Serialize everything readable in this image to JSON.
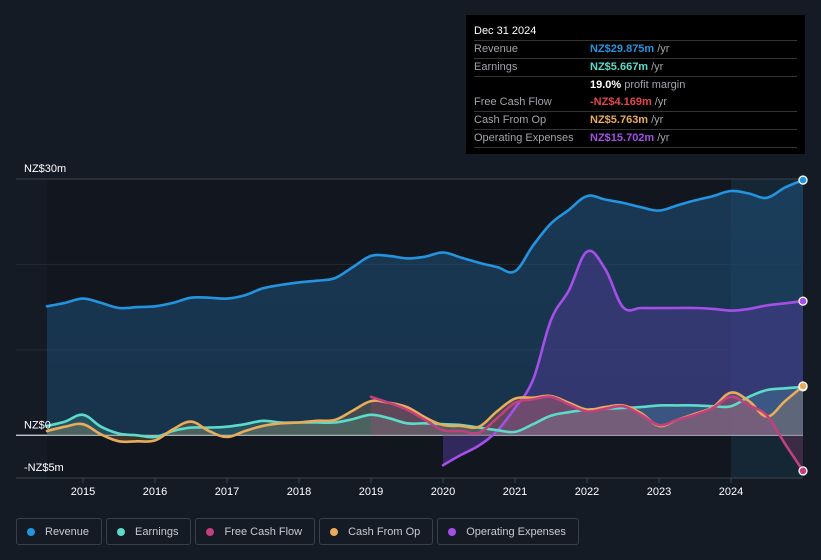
{
  "tooltip": {
    "date": "Dec 31 2024",
    "rows": [
      {
        "label": "Revenue",
        "value": "NZ$29.875m",
        "unit": "/yr",
        "color": "#2394df"
      },
      {
        "label": "Earnings",
        "value": "NZ$5.667m",
        "unit": "/yr",
        "color": "#5ddbc9"
      },
      {
        "label": "",
        "value": "19.0%",
        "unit": "profit margin",
        "color": "#ffffff"
      },
      {
        "label": "Free Cash Flow",
        "value": "-NZ$4.169m",
        "unit": "/yr",
        "color": "#e4474b"
      },
      {
        "label": "Cash From Op",
        "value": "NZ$5.763m",
        "unit": "/yr",
        "color": "#e9ac5a"
      },
      {
        "label": "Operating Expenses",
        "value": "NZ$15.702m",
        "unit": "/yr",
        "color": "#a450e8"
      }
    ]
  },
  "legend": [
    {
      "label": "Revenue",
      "color": "#2394df"
    },
    {
      "label": "Earnings",
      "color": "#5ddbc9"
    },
    {
      "label": "Free Cash Flow",
      "color": "#c2407f"
    },
    {
      "label": "Cash From Op",
      "color": "#e9ac5a"
    },
    {
      "label": "Operating Expenses",
      "color": "#a450e8"
    }
  ],
  "chart_data": {
    "type": "area",
    "title": "",
    "xlabel": "",
    "ylabel": "",
    "ylim": [
      -5,
      30
    ],
    "xlim": [
      2014.5,
      2025.0
    ],
    "y_ticks": [
      {
        "value": 30,
        "label": "NZ$30m"
      },
      {
        "value": 0,
        "label": "NZ$0"
      },
      {
        "value": -5,
        "label": "-NZ$5m"
      }
    ],
    "x_ticks": [
      {
        "value": 2015,
        "label": "2015"
      },
      {
        "value": 2016,
        "label": "2016"
      },
      {
        "value": 2017,
        "label": "2017"
      },
      {
        "value": 2018,
        "label": "2018"
      },
      {
        "value": 2019,
        "label": "2019"
      },
      {
        "value": 2020,
        "label": "2020"
      },
      {
        "value": 2021,
        "label": "2021"
      },
      {
        "value": 2022,
        "label": "2022"
      },
      {
        "value": 2023,
        "label": "2023"
      },
      {
        "value": 2024,
        "label": "2024"
      }
    ],
    "grid": true,
    "legend_position": "bottom-left",
    "highlight_start": 2024.0,
    "series": [
      {
        "name": "Revenue",
        "color": "#2394df",
        "points": [
          [
            2014.5,
            15.1
          ],
          [
            2014.75,
            15.5
          ],
          [
            2015.0,
            16.0
          ],
          [
            2015.25,
            15.5
          ],
          [
            2015.5,
            14.9
          ],
          [
            2015.75,
            15.0
          ],
          [
            2016.0,
            15.1
          ],
          [
            2016.25,
            15.5
          ],
          [
            2016.5,
            16.1
          ],
          [
            2016.75,
            16.1
          ],
          [
            2017.0,
            16.0
          ],
          [
            2017.25,
            16.4
          ],
          [
            2017.5,
            17.2
          ],
          [
            2017.75,
            17.6
          ],
          [
            2018.0,
            17.9
          ],
          [
            2018.25,
            18.1
          ],
          [
            2018.5,
            18.4
          ],
          [
            2018.75,
            19.7
          ],
          [
            2019.0,
            21.0
          ],
          [
            2019.25,
            21.0
          ],
          [
            2019.5,
            20.7
          ],
          [
            2019.75,
            20.9
          ],
          [
            2020.0,
            21.4
          ],
          [
            2020.25,
            20.8
          ],
          [
            2020.5,
            20.2
          ],
          [
            2020.75,
            19.7
          ],
          [
            2021.0,
            19.2
          ],
          [
            2021.25,
            22.2
          ],
          [
            2021.5,
            24.8
          ],
          [
            2021.75,
            26.4
          ],
          [
            2022.0,
            28.0
          ],
          [
            2022.25,
            27.6
          ],
          [
            2022.5,
            27.2
          ],
          [
            2022.75,
            26.7
          ],
          [
            2023.0,
            26.3
          ],
          [
            2023.25,
            26.9
          ],
          [
            2023.5,
            27.5
          ],
          [
            2023.75,
            28.0
          ],
          [
            2024.0,
            28.6
          ],
          [
            2024.25,
            28.3
          ],
          [
            2024.5,
            27.8
          ],
          [
            2024.75,
            29.0
          ],
          [
            2025.0,
            29.875
          ]
        ]
      },
      {
        "name": "Operating Expenses",
        "color": "#a450e8",
        "points": [
          [
            2020.0,
            -3.5
          ],
          [
            2020.25,
            -2.3
          ],
          [
            2020.5,
            -1.2
          ],
          [
            2020.75,
            0.5
          ],
          [
            2021.0,
            3.2
          ],
          [
            2021.25,
            6.5
          ],
          [
            2021.5,
            13.5
          ],
          [
            2021.75,
            17.0
          ],
          [
            2022.0,
            21.5
          ],
          [
            2022.25,
            19.5
          ],
          [
            2022.5,
            15.0
          ],
          [
            2022.75,
            14.9
          ],
          [
            2023.0,
            14.9
          ],
          [
            2023.25,
            14.9
          ],
          [
            2023.5,
            14.9
          ],
          [
            2023.75,
            14.8
          ],
          [
            2024.0,
            14.6
          ],
          [
            2024.25,
            14.8
          ],
          [
            2024.5,
            15.2
          ],
          [
            2024.75,
            15.45
          ],
          [
            2025.0,
            15.702
          ]
        ]
      },
      {
        "name": "Earnings",
        "color": "#5ddbc9",
        "points": [
          [
            2014.5,
            1.1
          ],
          [
            2014.75,
            1.6
          ],
          [
            2015.0,
            2.4
          ],
          [
            2015.25,
            1.0
          ],
          [
            2015.5,
            0.2
          ],
          [
            2015.75,
            0.0
          ],
          [
            2016.0,
            -0.2
          ],
          [
            2016.25,
            0.5
          ],
          [
            2016.5,
            0.9
          ],
          [
            2016.75,
            0.9
          ],
          [
            2017.0,
            1.0
          ],
          [
            2017.25,
            1.3
          ],
          [
            2017.5,
            1.7
          ],
          [
            2017.75,
            1.5
          ],
          [
            2018.0,
            1.5
          ],
          [
            2018.25,
            1.5
          ],
          [
            2018.5,
            1.5
          ],
          [
            2018.75,
            1.9
          ],
          [
            2019.0,
            2.4
          ],
          [
            2019.25,
            2.0
          ],
          [
            2019.5,
            1.4
          ],
          [
            2019.75,
            1.4
          ],
          [
            2020.0,
            1.3
          ],
          [
            2020.25,
            1.2
          ],
          [
            2020.5,
            0.9
          ],
          [
            2020.75,
            0.6
          ],
          [
            2021.0,
            0.4
          ],
          [
            2021.25,
            1.3
          ],
          [
            2021.5,
            2.3
          ],
          [
            2021.75,
            2.7
          ],
          [
            2022.0,
            3.0
          ],
          [
            2022.25,
            3.1
          ],
          [
            2022.5,
            3.2
          ],
          [
            2022.75,
            3.3
          ],
          [
            2023.0,
            3.5
          ],
          [
            2023.25,
            3.5
          ],
          [
            2023.5,
            3.5
          ],
          [
            2023.75,
            3.4
          ],
          [
            2024.0,
            3.4
          ],
          [
            2024.25,
            4.5
          ],
          [
            2024.5,
            5.3
          ],
          [
            2024.75,
            5.5
          ],
          [
            2025.0,
            5.667
          ]
        ]
      },
      {
        "name": "Cash From Op",
        "color": "#e9ac5a",
        "points": [
          [
            2014.5,
            0.5
          ],
          [
            2014.75,
            1.0
          ],
          [
            2015.0,
            1.3
          ],
          [
            2015.25,
            0.1
          ],
          [
            2015.5,
            -0.7
          ],
          [
            2015.75,
            -0.7
          ],
          [
            2016.0,
            -0.6
          ],
          [
            2016.25,
            0.7
          ],
          [
            2016.5,
            1.6
          ],
          [
            2016.75,
            0.5
          ],
          [
            2017.0,
            -0.2
          ],
          [
            2017.25,
            0.5
          ],
          [
            2017.5,
            1.1
          ],
          [
            2017.75,
            1.4
          ],
          [
            2018.0,
            1.5
          ],
          [
            2018.25,
            1.7
          ],
          [
            2018.5,
            1.8
          ],
          [
            2018.75,
            2.9
          ],
          [
            2019.0,
            4.0
          ],
          [
            2019.25,
            3.8
          ],
          [
            2019.5,
            3.3
          ],
          [
            2019.75,
            2.1
          ],
          [
            2020.0,
            1.2
          ],
          [
            2020.25,
            1.1
          ],
          [
            2020.5,
            1.0
          ],
          [
            2020.75,
            2.8
          ],
          [
            2021.0,
            4.3
          ],
          [
            2021.25,
            4.4
          ],
          [
            2021.5,
            4.6
          ],
          [
            2021.75,
            3.8
          ],
          [
            2022.0,
            3.0
          ],
          [
            2022.25,
            3.3
          ],
          [
            2022.5,
            3.5
          ],
          [
            2022.75,
            2.6
          ],
          [
            2023.0,
            1.1
          ],
          [
            2023.25,
            1.8
          ],
          [
            2023.5,
            2.5
          ],
          [
            2023.75,
            3.3
          ],
          [
            2024.0,
            5.0
          ],
          [
            2024.25,
            4.0
          ],
          [
            2024.5,
            2.2
          ],
          [
            2024.75,
            4.0
          ],
          [
            2025.0,
            5.763
          ]
        ]
      },
      {
        "name": "Free Cash Flow",
        "color": "#c2407f",
        "points": [
          [
            2019.0,
            4.5
          ],
          [
            2019.25,
            3.8
          ],
          [
            2019.5,
            3.0
          ],
          [
            2019.75,
            1.8
          ],
          [
            2020.0,
            0.6
          ],
          [
            2020.25,
            0.5
          ],
          [
            2020.5,
            0.3
          ],
          [
            2020.75,
            2.0
          ],
          [
            2021.0,
            3.8
          ],
          [
            2021.25,
            4.2
          ],
          [
            2021.5,
            4.5
          ],
          [
            2021.75,
            3.6
          ],
          [
            2022.0,
            2.8
          ],
          [
            2022.25,
            3.1
          ],
          [
            2022.5,
            3.4
          ],
          [
            2022.75,
            2.4
          ],
          [
            2023.0,
            1.2
          ],
          [
            2023.25,
            1.8
          ],
          [
            2023.5,
            2.4
          ],
          [
            2023.75,
            3.2
          ],
          [
            2024.0,
            4.5
          ],
          [
            2024.25,
            3.5
          ],
          [
            2024.5,
            2.3
          ],
          [
            2024.75,
            -1.0
          ],
          [
            2025.0,
            -4.169
          ]
        ]
      }
    ]
  }
}
